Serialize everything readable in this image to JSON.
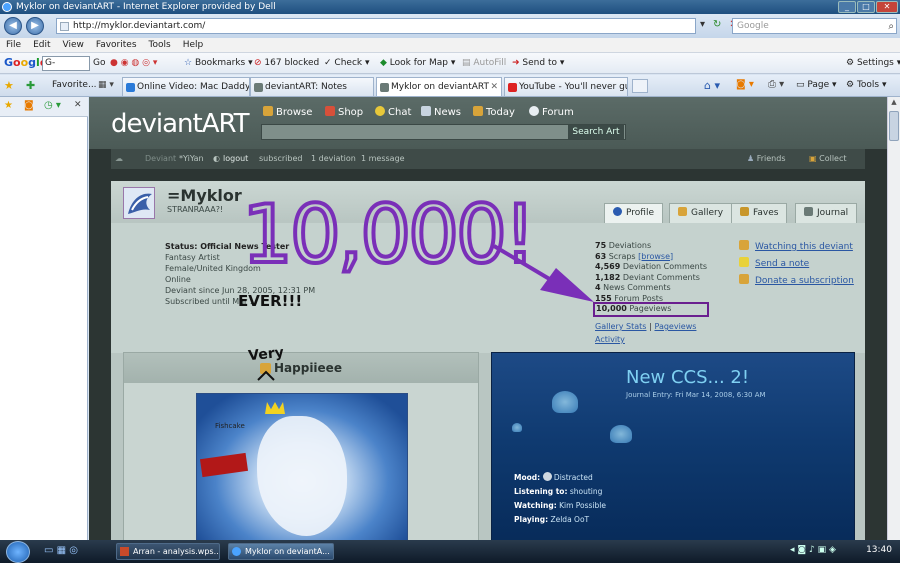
{
  "window": {
    "title": "Myklor on deviantART - Internet Explorer provided by Dell"
  },
  "address": {
    "url": "http://myklor.deviantart.com/",
    "search_placeholder": "Google"
  },
  "menu": [
    "File",
    "Edit",
    "View",
    "Favorites",
    "Tools",
    "Help"
  ],
  "google_toolbar": {
    "logo": [
      "G",
      "o",
      "o",
      "g",
      "l",
      "e"
    ],
    "box": "G-",
    "go": "Go",
    "bookmarks": "Bookmarks",
    "blocked": "167 blocked",
    "check": "Check",
    "lookup": "Look for Map",
    "autofill": "AutoFill",
    "sendto": "Send to",
    "settings": "Settings"
  },
  "tabs": [
    {
      "label": "Favorite..."
    },
    {
      "label": "Online Video: Mac Daddy |..."
    },
    {
      "label": "deviantART: Notes"
    },
    {
      "label": "Myklor on deviantART"
    },
    {
      "label": "YouTube - You'll never gu..."
    }
  ],
  "tabtools": {
    "page": "Page",
    "tools": "Tools"
  },
  "da": {
    "logo": "deviantART",
    "nav": [
      "Browse",
      "Shop",
      "Chat",
      "News",
      "Today",
      "Forum"
    ],
    "search_btn": "Search Art",
    "subbar": {
      "deviant": "Deviant",
      "user": "*YiYan",
      "logout": "logout",
      "subscribed": "subscribed",
      "deviation": "1 deviation",
      "message": "1 message",
      "friends": "Friends",
      "collect": "Collect"
    }
  },
  "profile": {
    "name": "=Myklor",
    "tagline": "STRANRAAA?!",
    "tabs": [
      "Profile",
      "Gallery",
      "Faves",
      "Journal"
    ],
    "info": [
      "Status: Official News Tester",
      "Fantasy Artist",
      "Female/United Kingdom",
      "Online",
      "Deviant since Jun 28, 2005, 12:31 PM",
      "Subscribed until Mar ..."
    ],
    "stats": [
      {
        "num": "75",
        "label": "Deviations"
      },
      {
        "num": "63",
        "label": "Scraps",
        "extra": "[browse]"
      },
      {
        "num": "4,569",
        "label": "Deviation Comments"
      },
      {
        "num": "1,182",
        "label": "Deviant Comments"
      },
      {
        "num": "4",
        "label": "News Comments"
      },
      {
        "num": "155",
        "label": "Forum Posts"
      },
      {
        "num": "10,000",
        "label": "Pageviews"
      }
    ],
    "stat_links": {
      "gallery_stats": "Gallery Stats",
      "sep": "|",
      "pageviews": "Pageviews",
      "activity": "Activity"
    },
    "actions": [
      "Watching this deviant",
      "Send a note",
      "Donate a subscription"
    ],
    "featured_title": "Happiieee",
    "dragon_tag": "Fishcake"
  },
  "journal": {
    "title": "New CCS... 2!",
    "date": "Journal Entry: Fri Mar 14, 2008, 6:30 AM",
    "mood": [
      {
        "k": "Mood:",
        "v": "Distracted"
      },
      {
        "k": "Listening to:",
        "v": "shouting"
      },
      {
        "k": "Watching:",
        "v": "Kim Possible"
      },
      {
        "k": "Playing:",
        "v": "Zelda OoT"
      }
    ]
  },
  "annotations": {
    "big": "10,000!",
    "ever": "EVER!!!",
    "very": "Very",
    "colors": {
      "purple": "#7a2fb8",
      "outline": "#4a1378"
    }
  },
  "taskbar": {
    "items": [
      "Arran - analysis.wps...",
      "Myklor on deviantA..."
    ],
    "clock": "13:40"
  }
}
